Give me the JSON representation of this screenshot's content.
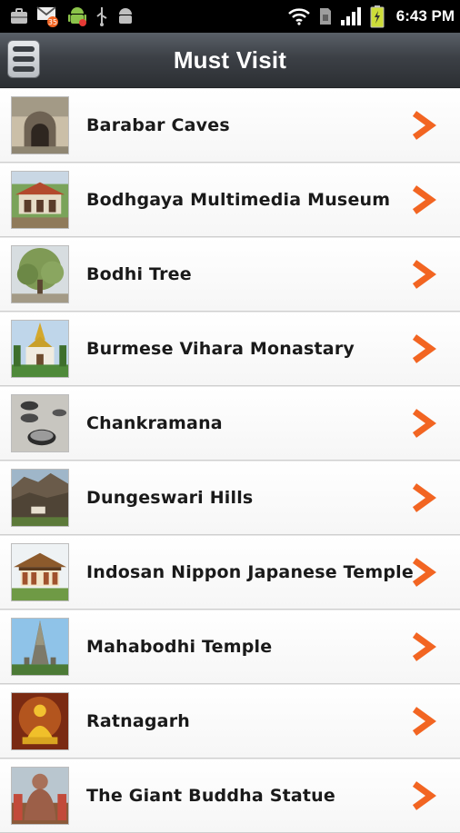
{
  "status_bar": {
    "time": "6:43 PM",
    "left_icons": [
      "briefcase-icon",
      "email-icon",
      "android-icon",
      "usb-icon",
      "android-debug-icon"
    ],
    "right_icons": [
      "wifi-icon",
      "sim-icon",
      "signal-icon",
      "battery-icon"
    ]
  },
  "header": {
    "title": "Must Visit",
    "menu_icon": "menu-icon"
  },
  "colors": {
    "header_top": "#5a6068",
    "header_bottom": "#2c2f33",
    "chevron": "#f26522",
    "text": "#1a1a1a"
  },
  "places": [
    {
      "name": "Barabar Caves"
    },
    {
      "name": "Bodhgaya Multimedia Museum"
    },
    {
      "name": "Bodhi Tree"
    },
    {
      "name": "Burmese Vihara Monastary"
    },
    {
      "name": "Chankramana"
    },
    {
      "name": "Dungeswari Hills"
    },
    {
      "name": "Indosan Nippon Japanese Temple"
    },
    {
      "name": "Mahabodhi Temple"
    },
    {
      "name": "Ratnagarh"
    },
    {
      "name": "The Giant Buddha Statue"
    }
  ]
}
